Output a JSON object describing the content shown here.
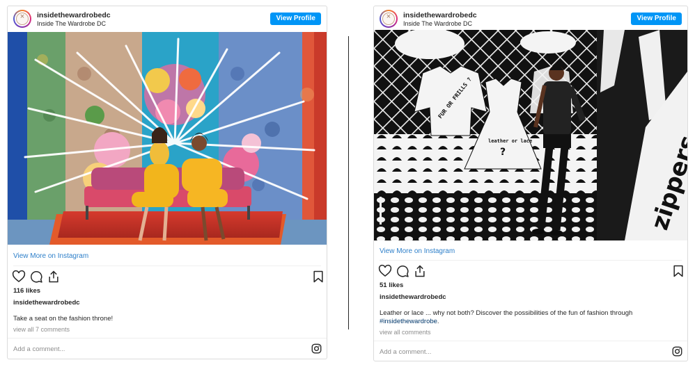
{
  "posts": [
    {
      "username": "insidethewardrobedc",
      "full_name": "Inside The Wardrobe DC",
      "view_profile": "View Profile",
      "view_more": "View More on Instagram",
      "likes": "116 likes",
      "caption_user": "insidethewardrobedc",
      "caption": "Take a seat on the fashion throne!",
      "view_all": "view all 7 comments",
      "add_comment": "Add a comment..."
    },
    {
      "username": "insidethewardrobedc",
      "full_name": "Inside The Wardrobe DC",
      "view_profile": "View Profile",
      "view_more": "View More on Instagram",
      "likes": "51 likes",
      "caption_user": "insidethewardrobedc",
      "caption": "Leather or lace ... why not both? Discover the possibilities of the fun of fashion through",
      "caption_tag": "#insidethewardrobe",
      "caption_end": ".",
      "view_all": "view all comments",
      "add_comment": "Add a comment...",
      "photo_text": {
        "jacket_note": "FUR OR FRILLS ?",
        "dress_note": "leather or lace",
        "dress_q": "?",
        "wall_text": "zippers or"
      }
    }
  ],
  "colors": {
    "accent": "#0095f6",
    "link": "#2d7fc9",
    "muted": "#8e8e8e",
    "border": "#dbdbdb"
  },
  "icons": [
    "heart-icon",
    "comment-icon",
    "share-icon",
    "bookmark-icon",
    "instagram-icon"
  ]
}
